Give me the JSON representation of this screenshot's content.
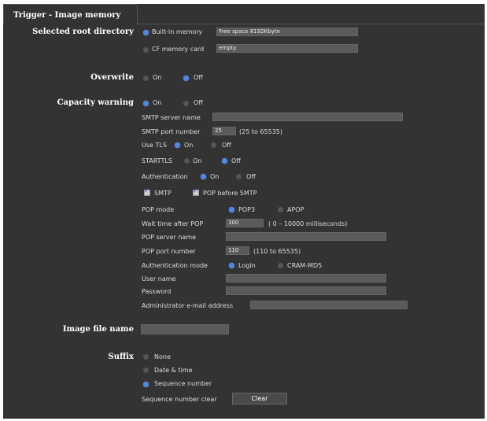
{
  "tab": {
    "title": "Trigger - Image memory"
  },
  "root_directory": {
    "label": "Selected root directory",
    "builtin": {
      "label": "Built-in memory",
      "selected": true,
      "info": "Free space  8192Kbyte"
    },
    "cf": {
      "label": "CF memory card",
      "selected": false,
      "info": "empty"
    }
  },
  "overwrite": {
    "label": "Overwrite",
    "on_label": "On",
    "off_label": "Off",
    "value": "Off"
  },
  "capacity": {
    "label": "Capacity warning",
    "on_label": "On",
    "off_label": "Off",
    "value": "On",
    "smtp_server_label": "SMTP server name",
    "smtp_server_value": "",
    "smtp_port_label": "SMTP port number",
    "smtp_port_value": "25",
    "smtp_port_range": "(25 to 65535)",
    "tls_label": "Use TLS",
    "tls_on": "On",
    "tls_off": "Off",
    "starttls_label": "STARTTLS",
    "starttls_on": "On",
    "starttls_off": "Off",
    "auth_label": "Authentication",
    "auth_on": "On",
    "auth_off": "Off",
    "smtp_check_label": "SMTP",
    "pop_before_smtp_label": "POP before SMTP",
    "pop_mode_label": "POP mode",
    "pop3_label": "POP3",
    "apop_label": "APOP",
    "wait_label": "Wait time after POP",
    "wait_value": "300",
    "wait_range": "( 0 – 10000 milliseconds)",
    "pop_server_label": "POP server name",
    "pop_server_value": "",
    "pop_port_label": "POP port number",
    "pop_port_value": "110",
    "pop_port_range": "(110 to 65535)",
    "auth_mode_label": "Authentication mode",
    "login_label": "Login",
    "cram_label": "CRAM-MD5",
    "user_label": "User name",
    "user_value": "",
    "password_label": "Password",
    "password_value": "",
    "admin_email_label": "Administrator e-mail address",
    "admin_email_value": ""
  },
  "image_file": {
    "label": "Image file name",
    "value": ""
  },
  "suffix": {
    "label": "Suffix",
    "none_label": "None",
    "date_label": "Date & time",
    "seq_label": "Sequence number",
    "value": "Sequence number",
    "clear_label": "Sequence number clear",
    "clear_button": "Clear"
  },
  "colors": {
    "panel": "#333333",
    "radio_on": "#4f86e8",
    "radio_off": "#555555",
    "field": "#5a5a5a"
  }
}
